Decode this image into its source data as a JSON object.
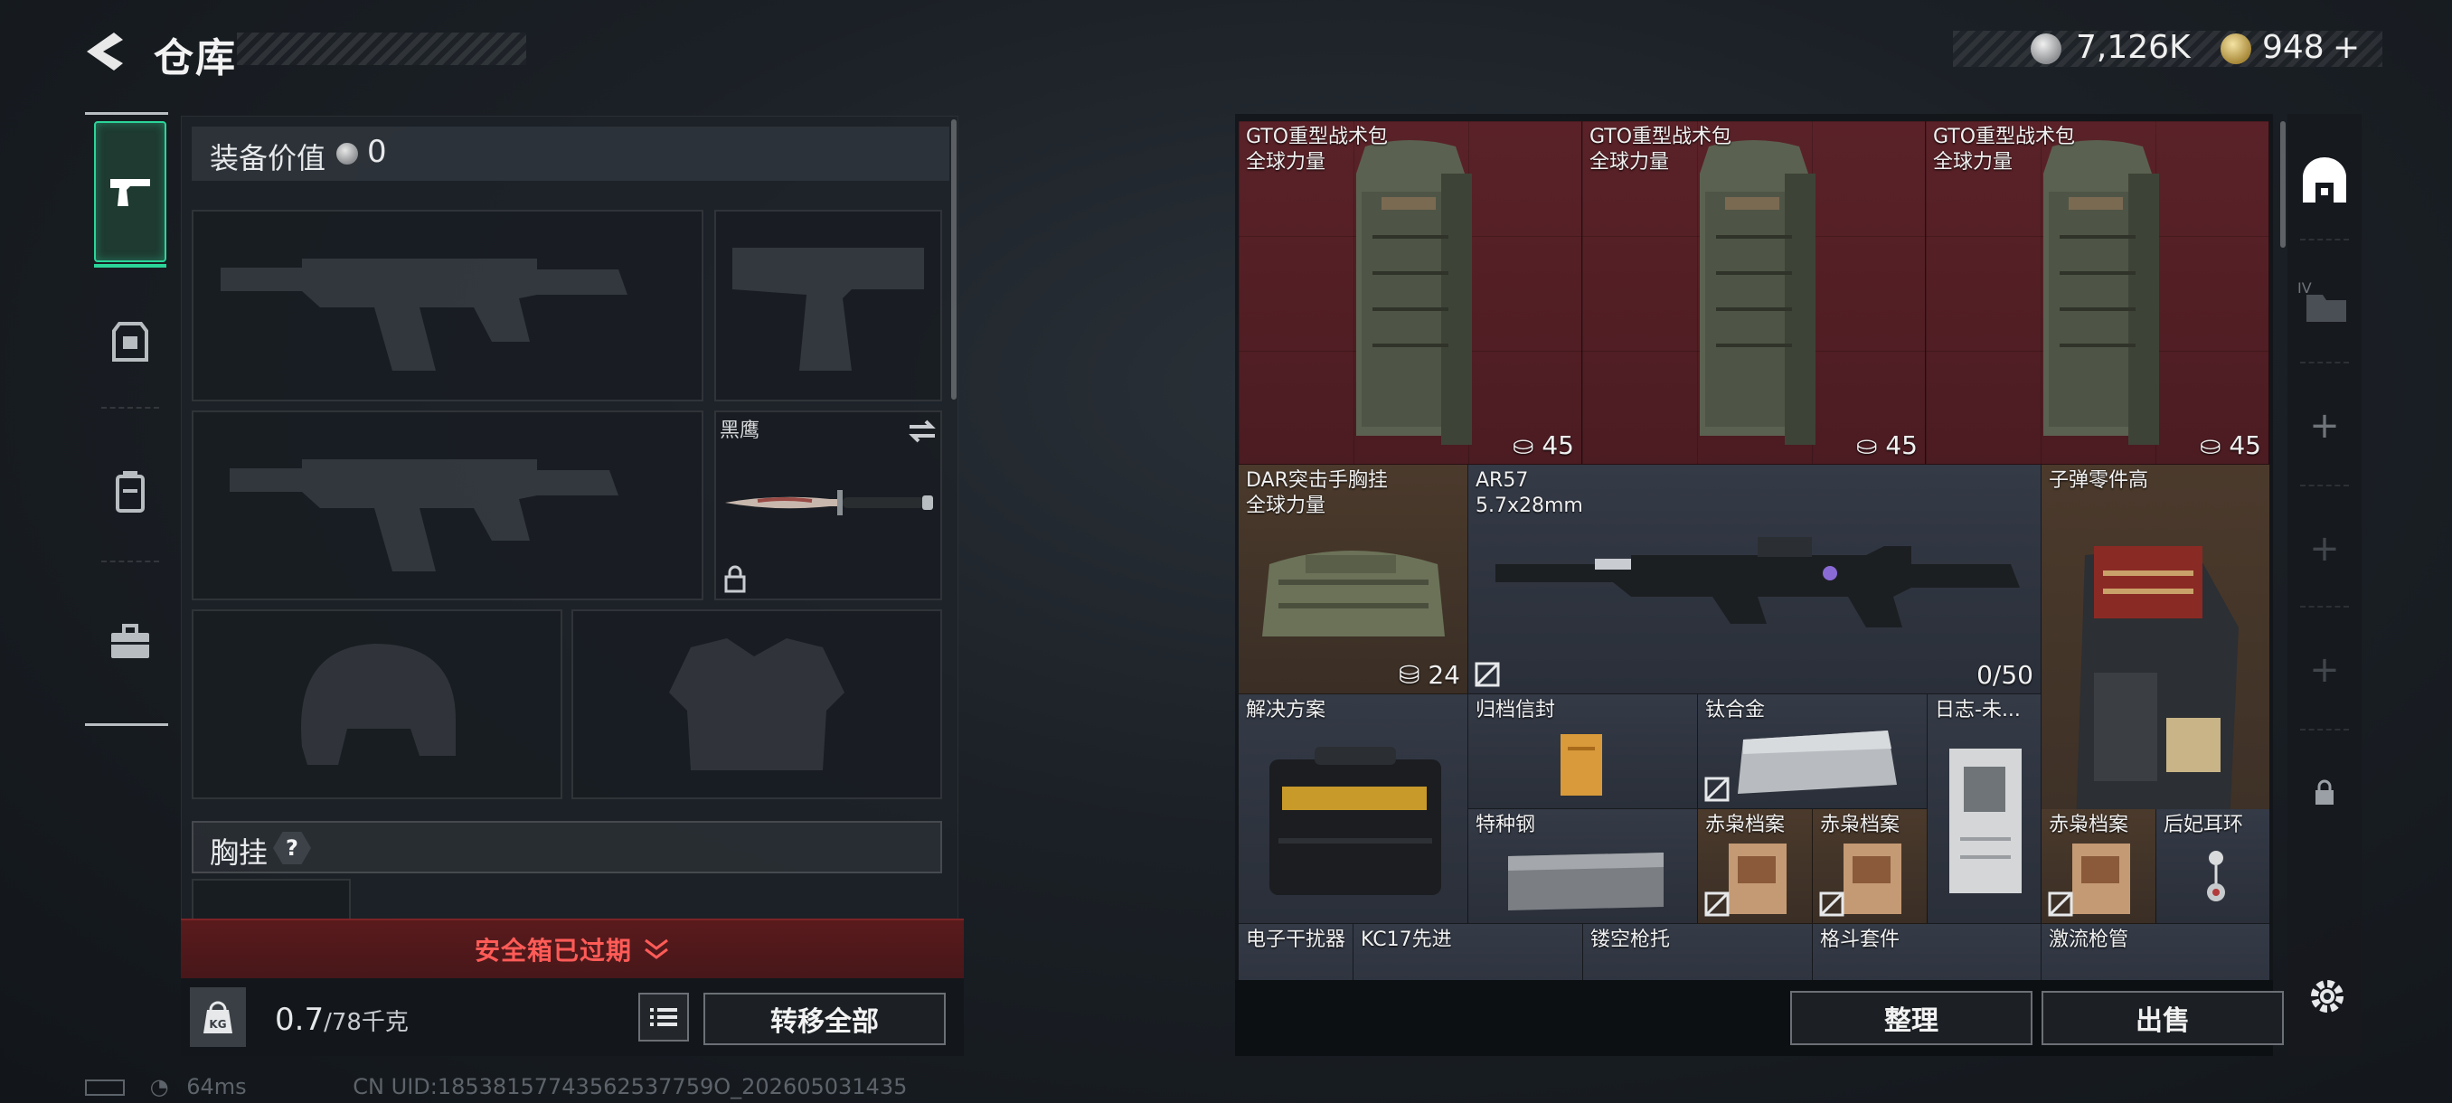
{
  "header": {
    "title": "仓库",
    "currency_silver": "7,126K",
    "currency_gold": "948",
    "currency_add": "+"
  },
  "left": {
    "value_label": "装备价值",
    "value_amount": "0",
    "knife_name": "黑鹰",
    "chest_label": "胸挂",
    "help_label": "?",
    "safe_box_text": "安全箱已过期",
    "weight_current": "0.7",
    "weight_max": "/78千克",
    "transfer_all": "转移全部"
  },
  "items": {
    "backpack_name": "GTO重型战术包",
    "backpack_sub": "全球力量",
    "backpack_count": "45",
    "rig_name": "DAR突击手胸挂",
    "rig_sub": "全球力量",
    "rig_count": "24",
    "rifle_name": "AR57",
    "rifle_sub": "5.7x28mm",
    "rifle_ammo": "0/50",
    "ammo_parts": "子弹零件高",
    "solution": "解决方案",
    "archive_envelope": "归档信封",
    "titanium": "钛合金",
    "journal": "日志-未...",
    "special_steel": "特种钢",
    "archive_a": "赤枭档案",
    "archive_b": "赤枭档案",
    "archive_c": "赤枭档案",
    "earring": "后妃耳环",
    "jammer": "电子干扰器",
    "kc17": "KC17先进",
    "hollow_stock": "镂空枪托",
    "grapple_kit": "格斗套件",
    "flow_barrel": "激流枪管"
  },
  "actions": {
    "sort": "整理",
    "sell": "出售"
  },
  "status": {
    "ping": "64ms",
    "uid": "CN UID:18538157743562537759O_202605031435"
  },
  "colors": {
    "accent_green": "#2bd59a",
    "expired_red": "#ff5b57",
    "rare_red_bg": "#5a2228",
    "epic_brown_bg": "#4b3a2c"
  }
}
